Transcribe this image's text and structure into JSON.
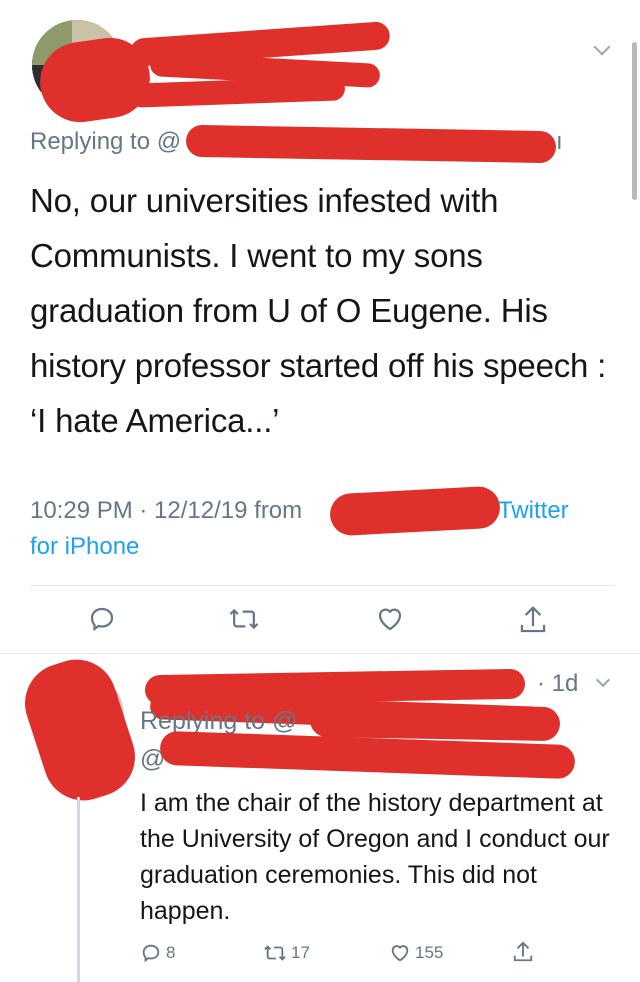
{
  "main_tweet": {
    "replying_to_label": "Replying to @",
    "replying_to_tail": "ı",
    "body": "No, our universities infested with Communists. I went to my sons graduation from  U of O Eugene. His history professor started off his speech : ‘I hate America...’",
    "timestamp": "10:29 PM · 12/12/19 from",
    "source_tail": "Twitter",
    "source_line2": "for iPhone"
  },
  "reply_tweet": {
    "age": "· 1d",
    "replying_to_label": "Replying to @",
    "second_handle_prefix": "@",
    "body": "I am the chair of the history department at the University of Oregon and I conduct our graduation ceremonies. This did not happen.",
    "counts": {
      "replies": "8",
      "retweets": "17",
      "likes": "155"
    }
  },
  "icons": {
    "reply": "reply-icon",
    "retweet": "retweet-icon",
    "like": "heart-icon",
    "share": "share-icon",
    "more": "chevron-down-icon"
  },
  "colors": {
    "link": "#1da1f2",
    "secondary_text": "#657786",
    "redaction": "#e0302b"
  }
}
